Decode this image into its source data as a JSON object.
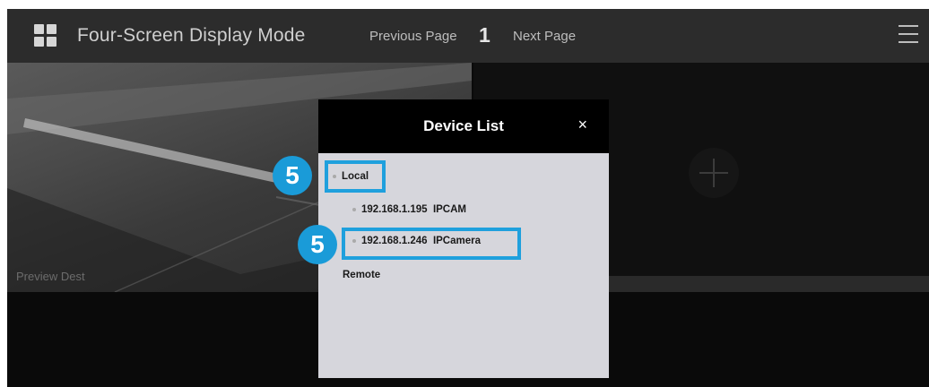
{
  "topbar": {
    "title": "Four-Screen Display Mode",
    "previous_label": "Previous Page",
    "page_number": "1",
    "next_label": "Next Page",
    "grid_icon": "grid-icon",
    "menu_icon": "hamburger-menu-icon"
  },
  "camera_tile": {
    "label": "Preview Dest"
  },
  "empty_tile": {
    "add_icon": "plus-icon"
  },
  "dialog": {
    "title": "Device List",
    "close_label": "×",
    "tree": {
      "local_label": "Local",
      "devices": [
        {
          "ip": "192.168.1.195",
          "name": "IPCAM"
        },
        {
          "ip": "192.168.1.246",
          "name": "IPCamera"
        }
      ],
      "remote_label": "Remote"
    }
  },
  "annotations": {
    "step_badges": [
      "5",
      "5"
    ],
    "accent_color": "#1fa0dd"
  }
}
